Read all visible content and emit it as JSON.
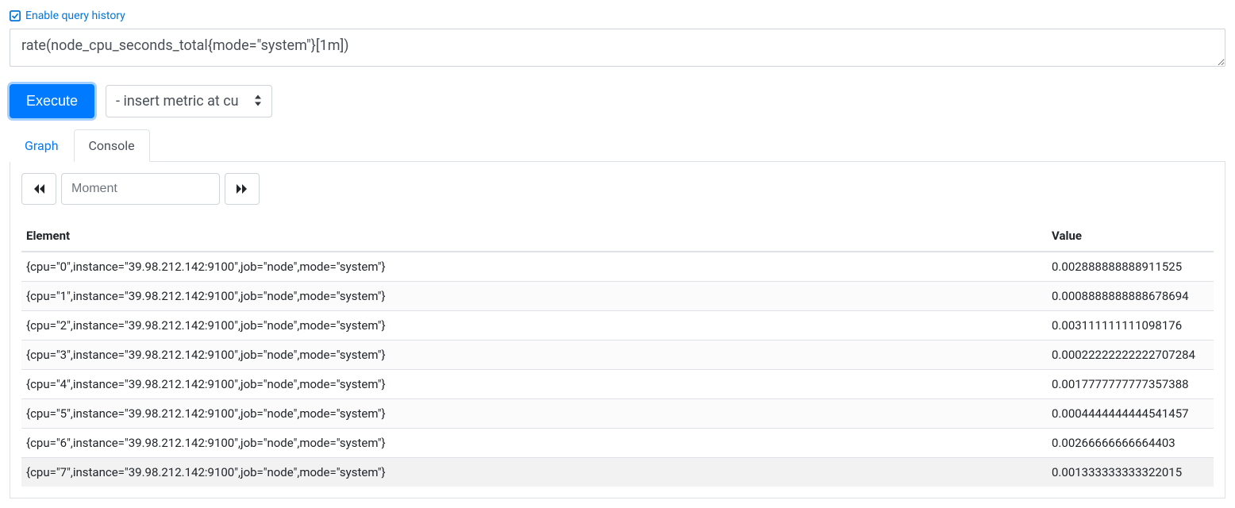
{
  "header": {
    "history_link": "Enable query history"
  },
  "query": {
    "value": "rate(node_cpu_seconds_total{mode=\"system\"}[1m])"
  },
  "controls": {
    "execute_label": "Execute",
    "metric_placeholder": "- insert metric at cu"
  },
  "tabs": {
    "graph": "Graph",
    "console": "Console"
  },
  "moment": {
    "placeholder": "Moment"
  },
  "table": {
    "headers": {
      "element": "Element",
      "value": "Value"
    },
    "rows": [
      {
        "element": "{cpu=\"0\",instance=\"39.98.212.142:9100\",job=\"node\",mode=\"system\"}",
        "value": "0.002888888888911525"
      },
      {
        "element": "{cpu=\"1\",instance=\"39.98.212.142:9100\",job=\"node\",mode=\"system\"}",
        "value": "0.0008888888888678694"
      },
      {
        "element": "{cpu=\"2\",instance=\"39.98.212.142:9100\",job=\"node\",mode=\"system\"}",
        "value": "0.003111111111098176"
      },
      {
        "element": "{cpu=\"3\",instance=\"39.98.212.142:9100\",job=\"node\",mode=\"system\"}",
        "value": "0.00022222222222707284"
      },
      {
        "element": "{cpu=\"4\",instance=\"39.98.212.142:9100\",job=\"node\",mode=\"system\"}",
        "value": "0.0017777777777357388"
      },
      {
        "element": "{cpu=\"5\",instance=\"39.98.212.142:9100\",job=\"node\",mode=\"system\"}",
        "value": "0.0004444444444541457"
      },
      {
        "element": "{cpu=\"6\",instance=\"39.98.212.142:9100\",job=\"node\",mode=\"system\"}",
        "value": "0.00266666666664403"
      },
      {
        "element": "{cpu=\"7\",instance=\"39.98.212.142:9100\",job=\"node\",mode=\"system\"}",
        "value": "0.001333333333322015"
      }
    ]
  }
}
